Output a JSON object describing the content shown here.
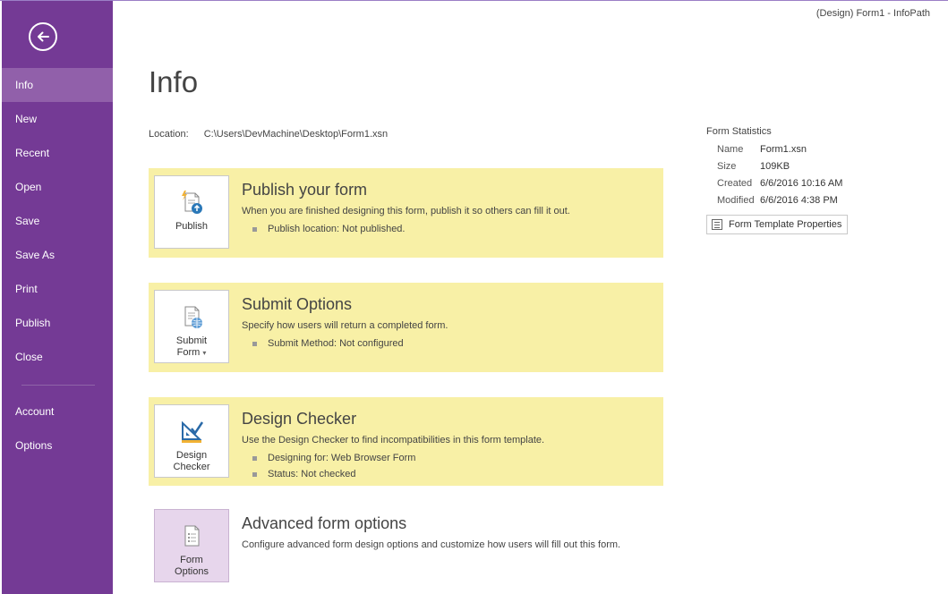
{
  "window": {
    "title": "(Design) Form1 - InfoPath"
  },
  "colors": {
    "sidebar": "#743a95",
    "sidebar_active": "#9160aa",
    "section_highlight": "#f8f0a6",
    "tile_purple": "#e7d6ec"
  },
  "sidebar": {
    "back_icon": "back-arrow-icon",
    "items": [
      {
        "label": "Info",
        "active": true
      },
      {
        "label": "New"
      },
      {
        "label": "Recent"
      },
      {
        "label": "Open"
      },
      {
        "label": "Save"
      },
      {
        "label": "Save As"
      },
      {
        "label": "Print"
      },
      {
        "label": "Publish"
      },
      {
        "label": "Close"
      }
    ],
    "bottom_items": [
      {
        "label": "Account"
      },
      {
        "label": "Options"
      }
    ]
  },
  "page": {
    "title": "Info",
    "location_label": "Location:",
    "location_value": "C:\\Users\\DevMachine\\Desktop\\Form1.xsn"
  },
  "sections": {
    "publish": {
      "tile_label": "Publish",
      "title": "Publish your form",
      "desc": "When you are finished designing this form, publish it so others can fill it out.",
      "bullets": [
        "Publish location: Not published."
      ]
    },
    "submit": {
      "tile_label_1": "Submit",
      "tile_label_2": "Form",
      "title": "Submit Options",
      "desc": "Specify how users will return a completed form.",
      "bullets": [
        "Submit Method: Not configured"
      ]
    },
    "checker": {
      "tile_label_1": "Design",
      "tile_label_2": "Checker",
      "title": "Design Checker",
      "desc": "Use the Design Checker to find incompatibilities in this form template.",
      "bullets": [
        "Designing for: Web Browser Form",
        "Status: Not checked"
      ]
    },
    "advanced": {
      "tile_label_1": "Form",
      "tile_label_2": "Options",
      "title": "Advanced form options",
      "desc": "Configure advanced form design options and customize how users will fill out this form."
    }
  },
  "stats": {
    "title": "Form Statistics",
    "rows": [
      {
        "key": "Name",
        "value": "Form1.xsn"
      },
      {
        "key": "Size",
        "value": "109KB"
      },
      {
        "key": "Created",
        "value": "6/6/2016 10:16 AM"
      },
      {
        "key": "Modified",
        "value": "6/6/2016 4:38 PM"
      }
    ],
    "button_label": "Form Template Properties"
  }
}
